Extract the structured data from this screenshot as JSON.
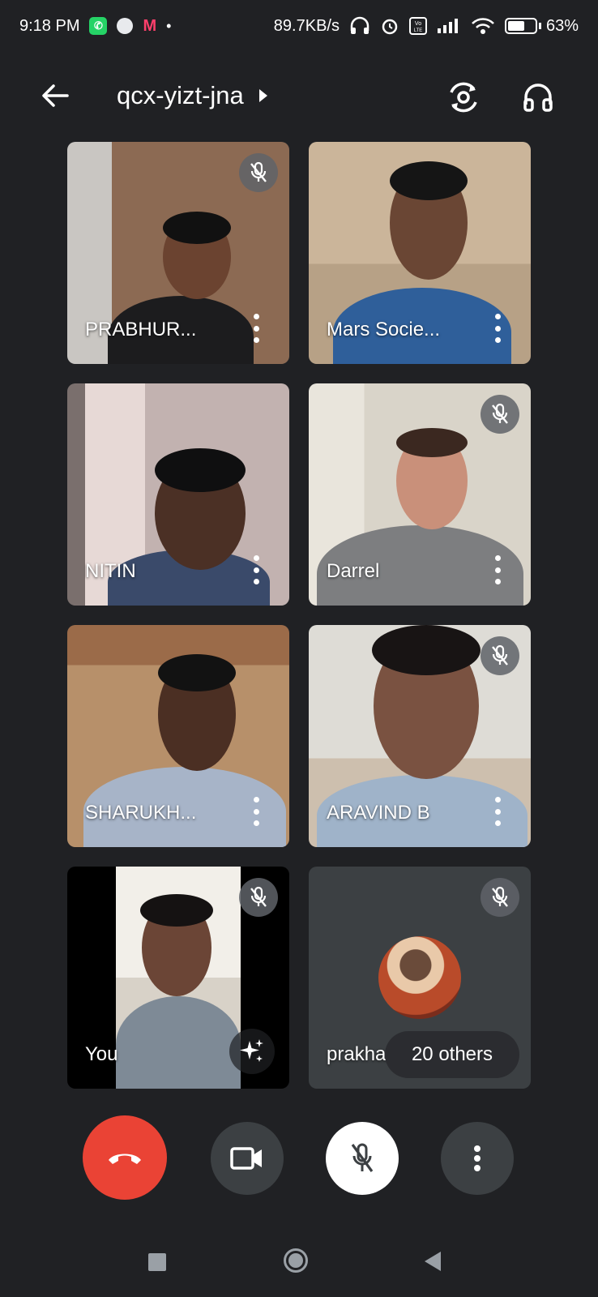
{
  "status_bar": {
    "time": "9:18 PM",
    "whatsapp_icon": "whatsapp-icon",
    "myntra_icon": "M",
    "dot": "•",
    "network_speed": "89.7KB/s",
    "volte": "Vo LTE",
    "battery_percent": "63%",
    "battery_level": 0.63
  },
  "top_bar": {
    "back_icon": "arrow-left-icon",
    "meeting_code": "qcx-yizt-jna",
    "switch_camera_icon": "camera-switch-icon",
    "audio_icon": "headphones-icon"
  },
  "participants": [
    {
      "name": "PRABHUR...",
      "muted": true
    },
    {
      "name": "Mars Socie...",
      "muted": false
    },
    {
      "name": "NITIN",
      "muted": false
    },
    {
      "name": "Darrel",
      "muted": true
    },
    {
      "name": "SHARUKH...",
      "muted": false
    },
    {
      "name": "ARAVIND B",
      "muted": true
    },
    {
      "name": "You",
      "muted": true,
      "effects_icon": "sparkle-icon"
    },
    {
      "name": "prakhar",
      "muted": true,
      "others_label": "20 others"
    }
  ],
  "controls": {
    "end_call_icon": "phone-hangup-icon",
    "camera_icon": "video-camera-icon",
    "mic_icon": "mic-off-icon",
    "more_icon": "more-vert-icon"
  },
  "colors": {
    "background": "#202124",
    "end_call": "#ea4335",
    "control_dark": "#3c4043",
    "control_light": "#ffffff"
  }
}
